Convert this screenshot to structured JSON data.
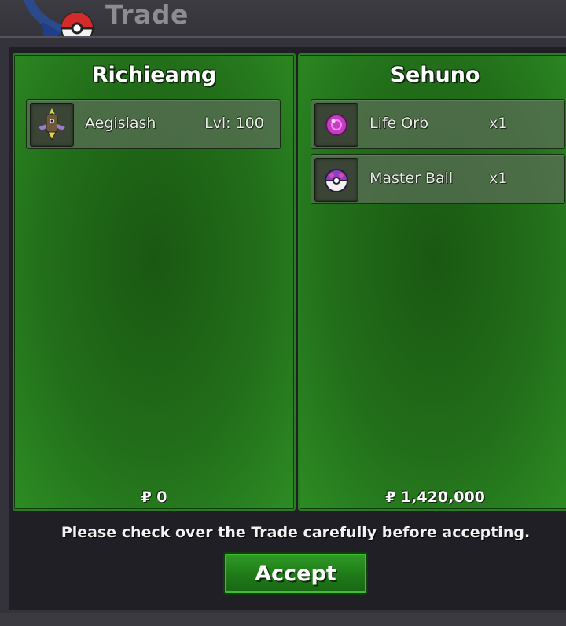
{
  "window": {
    "title": "Trade"
  },
  "left_party": {
    "name": "Richieamg",
    "items": [
      {
        "icon": "aegislash-sprite-icon",
        "name": "Aegislash",
        "detail": "Lvl: 100"
      }
    ],
    "money": "₽ 0"
  },
  "right_party": {
    "name": "Sehuno",
    "items": [
      {
        "icon": "life-orb-icon",
        "name": "Life Orb",
        "detail": "x1"
      },
      {
        "icon": "master-ball-icon",
        "name": "Master Ball",
        "detail": "x1"
      }
    ],
    "money": "₽ 1,420,000"
  },
  "footer": {
    "notice": "Please check over the Trade carefully before accepting.",
    "accept_label": "Accept"
  },
  "colors": {
    "panel_green": "#226e1a",
    "accept_green": "#1f7a18",
    "background": "#201f25"
  }
}
